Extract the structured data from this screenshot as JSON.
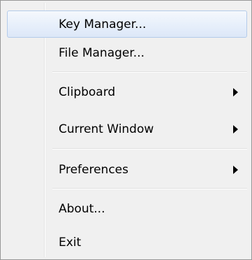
{
  "menu": {
    "items": [
      {
        "label": "Key Manager...",
        "has_submenu": false
      },
      {
        "label": "File Manager...",
        "has_submenu": false
      },
      {
        "label": "Clipboard",
        "has_submenu": true
      },
      {
        "label": "Current Window",
        "has_submenu": true
      },
      {
        "label": "Preferences",
        "has_submenu": true
      },
      {
        "label": "About...",
        "has_submenu": false
      },
      {
        "label": "Exit",
        "has_submenu": false
      }
    ],
    "highlighted_item": "Key Manager...",
    "submenu_arrow_icon": "chevron-right-icon"
  },
  "colors": {
    "menu_background": "#f0f0f0",
    "highlight_border": "#b4cbea",
    "highlight_fill": "#e8f0fb",
    "text": "#000000"
  }
}
